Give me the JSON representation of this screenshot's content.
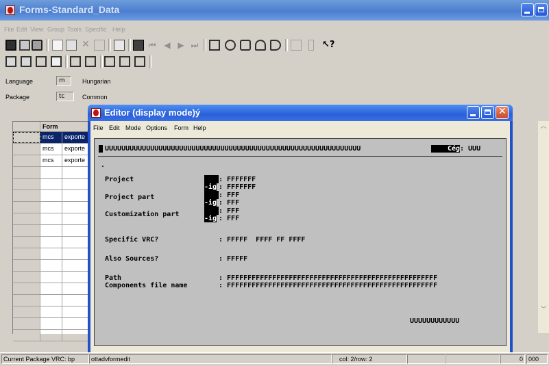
{
  "main_window": {
    "title": "Forms-Standard_Data",
    "menu": [
      "File",
      "Edit",
      "View",
      "Group",
      "Tools",
      "Specific",
      "Help"
    ]
  },
  "fields": {
    "language_label": "Language",
    "language_value": "m",
    "language_name": "Hungarian",
    "package_label": "Package",
    "package_value": "tc",
    "package_name": "Common"
  },
  "grid": {
    "header": "Form",
    "rows": [
      {
        "col1": "mcs",
        "col2": "exporte"
      },
      {
        "col1": "mcs",
        "col2": "exporte"
      },
      {
        "col1": "mcs",
        "col2": "exporte"
      }
    ]
  },
  "status": {
    "package_vrc": "Current Package VRC: bp",
    "session": "ottadvformedit",
    "position": "col: 2/row: 2",
    "pane_a": "0",
    "pane_b": "000"
  },
  "editor": {
    "title": "Editor (display mode)ý",
    "menu": [
      "File",
      "Edit",
      "Mode",
      "Options",
      "Form",
      "Help"
    ],
    "form": {
      "header_text": "UUUUUUUUUUUUUUUUUUUUUUUUUUUUUUUUUUUUUUUUUUUUUUUUUUUUUUUUUUUUUU",
      "company_label": "Cég",
      "company_value": ": UUU",
      "dot": ".",
      "project_label": "Project",
      "project_value": ": FFFFFFF",
      "project_to_label": "-ig",
      "project_to_value": ": FFFFFFF",
      "project_part_label": "Project part",
      "project_part_value": ": FFF",
      "project_part_to_label": "-ig",
      "project_part_to_value": ": FFF",
      "custom_part_label": "Customization part",
      "custom_part_value": ": FFF",
      "custom_part_to_label": "-ig",
      "custom_part_to_value": ": FFF",
      "specific_vrc_label": "Specific VRC?",
      "specific_vrc_value": ": FFFFF  FFFF FF FFFF",
      "also_sources_label": "Also Sources?",
      "also_sources_value": ": FFFFF",
      "path_label": "Path",
      "path_value": ": FFFFFFFFFFFFFFFFFFFFFFFFFFFFFFFFFFFFFFFFFFFFFFFFFFF",
      "components_label": "Components file name",
      "components_value": ": FFFFFFFFFFFFFFFFFFFFFFFFFFFFFFFFFFFFFFFFFFFFFFFFFFF",
      "footer_text": "UUUUUUUUUUUU"
    }
  },
  "colors": {
    "xp_title_blue": "#2a5fd8",
    "form_gray": "#c0c0c0",
    "selection_navy": "#0a246a"
  }
}
